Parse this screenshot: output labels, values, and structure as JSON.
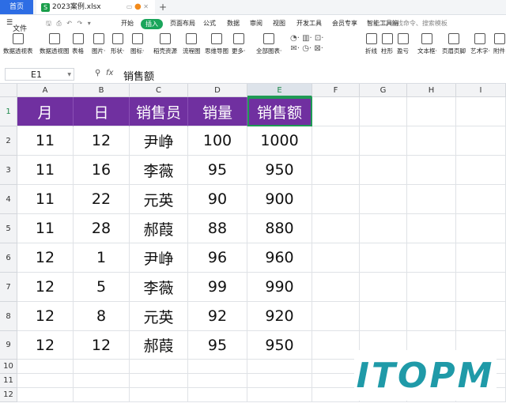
{
  "titlebar": {
    "home_tab": "首页",
    "file_tab": "2023案例.xlsx",
    "file_icon": "S",
    "new_tab": "+"
  },
  "menubar": {
    "file_label": "文件",
    "items": [
      "开始",
      "插入",
      "页面布局",
      "公式",
      "数据",
      "审阅",
      "视图",
      "开发工具",
      "会员专享",
      "智能工具箱"
    ],
    "active_item": "插入",
    "search_placeholder": "Q 查找命令、搜索模板"
  },
  "toolbar": {
    "tools": [
      "数据透视表",
      "数据透视图",
      "表格",
      "图片·",
      "形状·",
      "图标·",
      "稻壳资源",
      "流程图",
      "思维导图",
      "更多·",
      "全部图表·",
      "",
      "",
      "",
      "折线",
      "柱形",
      "盈亏",
      "文本框·",
      "页眉页脚",
      "艺术字·",
      "附件"
    ]
  },
  "formula_bar": {
    "cell_ref": "E1",
    "fx_label": "fx",
    "content": "销售额"
  },
  "sheet": {
    "columns": [
      "A",
      "B",
      "C",
      "D",
      "E",
      "F",
      "G",
      "H",
      "I"
    ],
    "selected_column": "E",
    "rows": [
      "1",
      "2",
      "3",
      "4",
      "5",
      "6",
      "7",
      "8",
      "9",
      "10",
      "11",
      "12"
    ],
    "selected_row": "1",
    "header": [
      "月",
      "日",
      "销售员",
      "销量",
      "销售额"
    ],
    "data": [
      [
        "11",
        "12",
        "尹峥",
        "100",
        "1000"
      ],
      [
        "11",
        "16",
        "李薇",
        "95",
        "950"
      ],
      [
        "11",
        "22",
        "元英",
        "90",
        "900"
      ],
      [
        "11",
        "28",
        "郝葭",
        "88",
        "880"
      ],
      [
        "12",
        "1",
        "尹峥",
        "96",
        "960"
      ],
      [
        "12",
        "5",
        "李薇",
        "99",
        "990"
      ],
      [
        "12",
        "8",
        "元英",
        "92",
        "920"
      ],
      [
        "12",
        "12",
        "郝葭",
        "95",
        "950"
      ]
    ],
    "header_color": "#7030a0",
    "selection_color": "#1f9a55"
  },
  "watermark": {
    "text": "ITOPM"
  }
}
